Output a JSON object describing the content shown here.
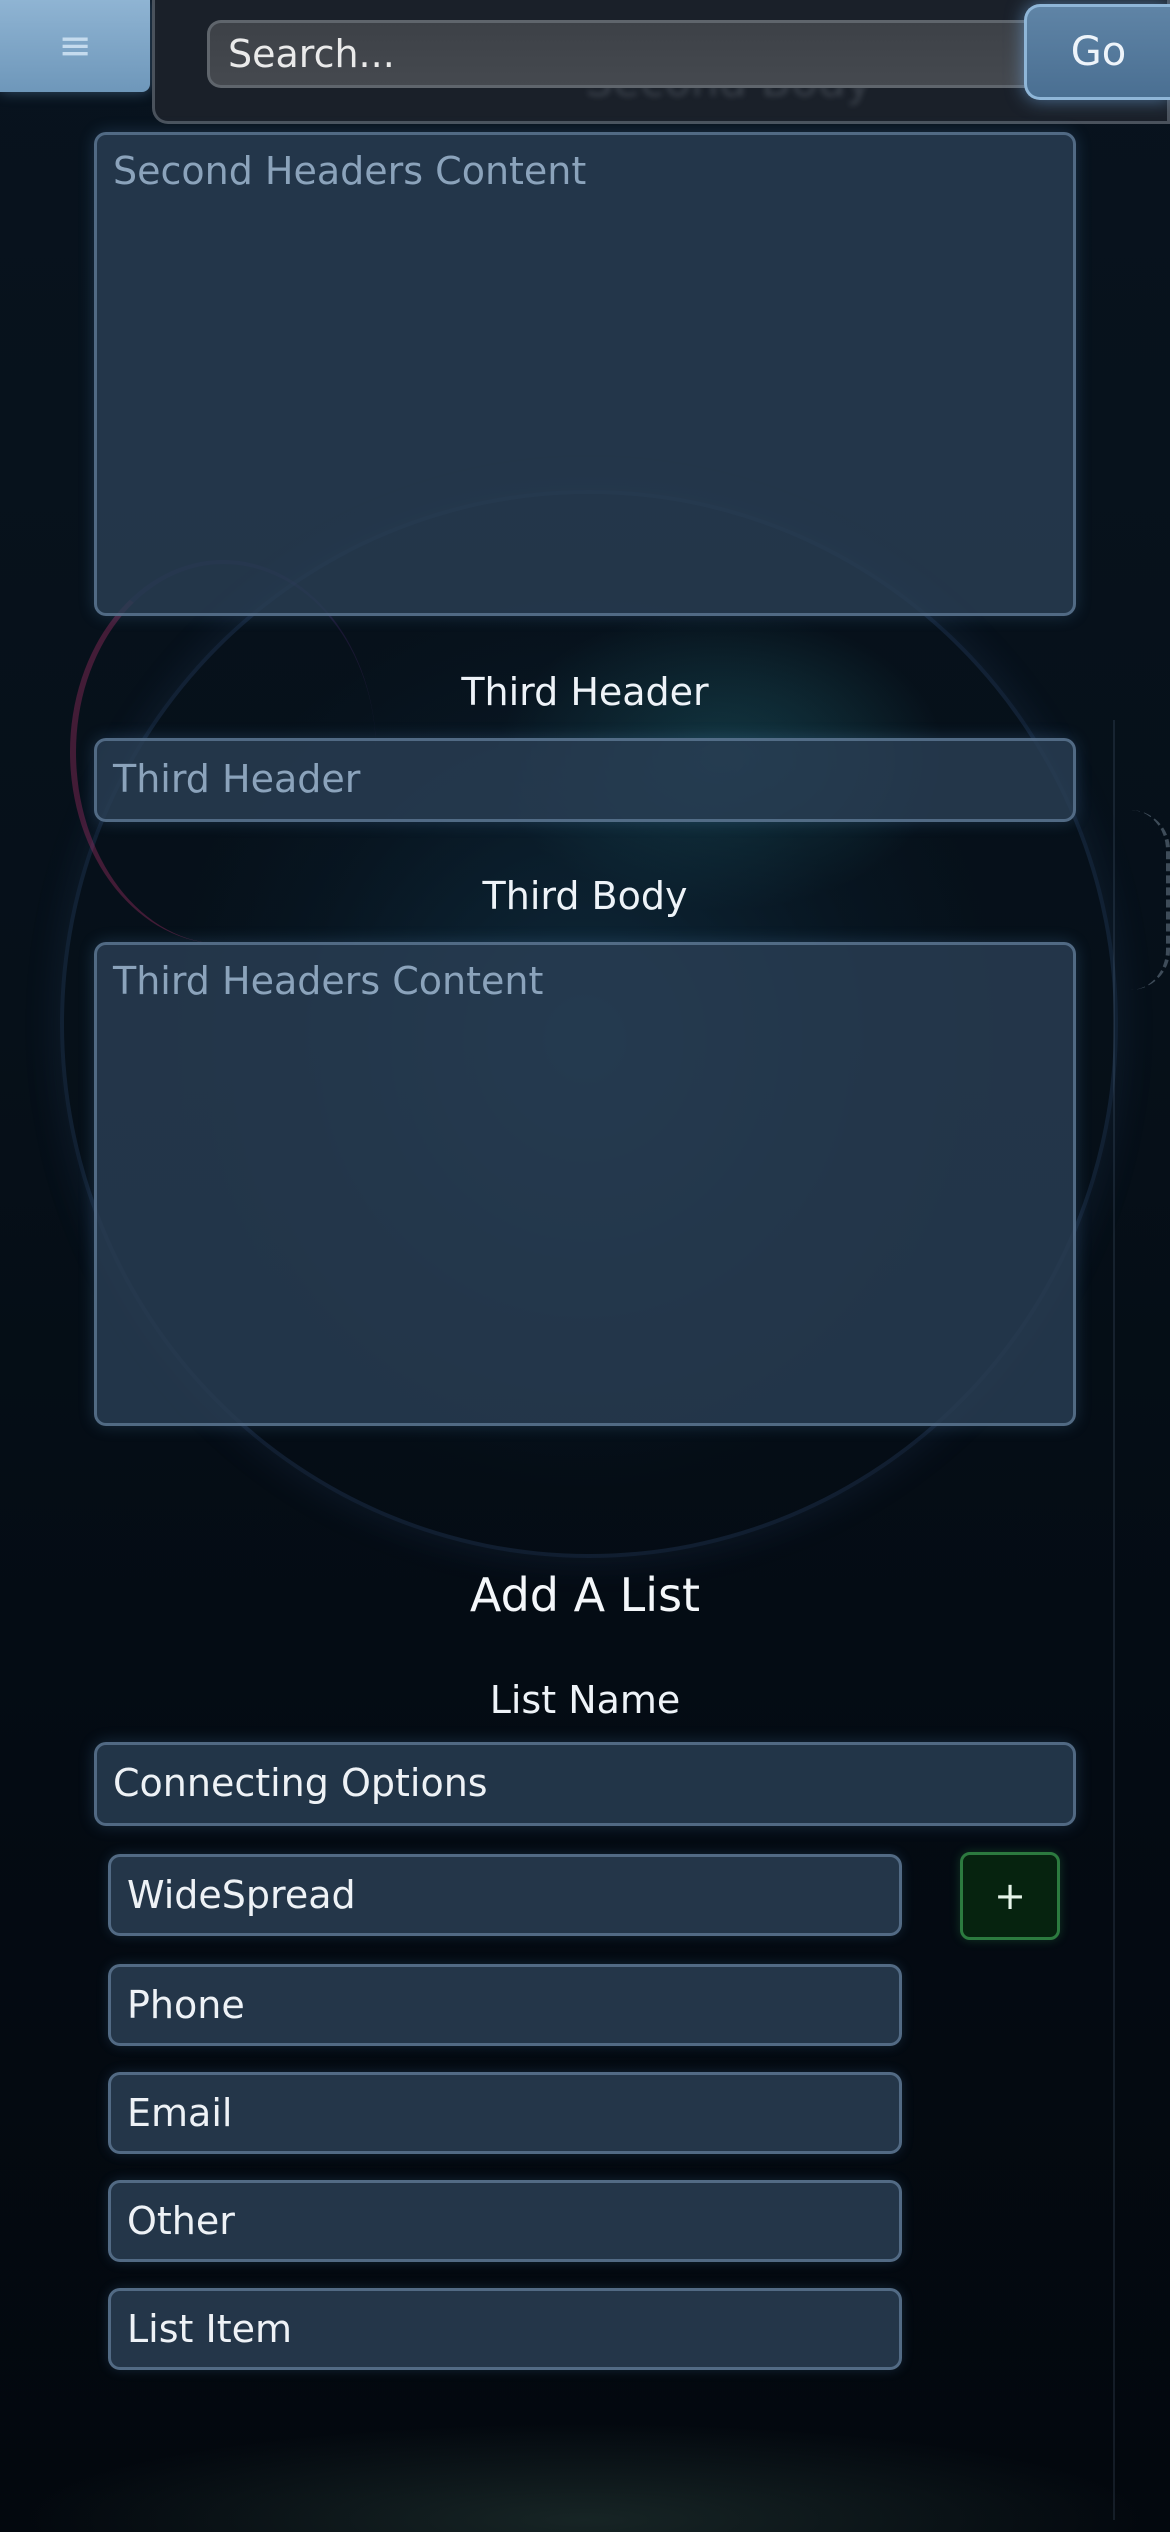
{
  "header": {
    "menu_icon": "hamburger-icon",
    "menu_glyph": "≡",
    "search_placeholder": "Search...",
    "go_label": "Go",
    "behind_text": "Second Body"
  },
  "sections": {
    "second": {
      "content_placeholder": "Second Headers Content"
    },
    "third": {
      "header_label": "Third Header",
      "header_placeholder": "Third Header",
      "body_label": "Third Body",
      "content_placeholder": "Third Headers Content"
    }
  },
  "list_form": {
    "title": "Add A List",
    "name_label": "List Name",
    "name_value": "Connecting Options",
    "add_button": "+",
    "items": [
      "WideSpread",
      "Phone",
      "Email",
      "Other",
      "List Item"
    ]
  },
  "colors": {
    "accent": "#6e97ba",
    "field_bg": "#2a3e54",
    "add_button_bg": "#06230f",
    "add_button_border": "#2c7a3f"
  }
}
